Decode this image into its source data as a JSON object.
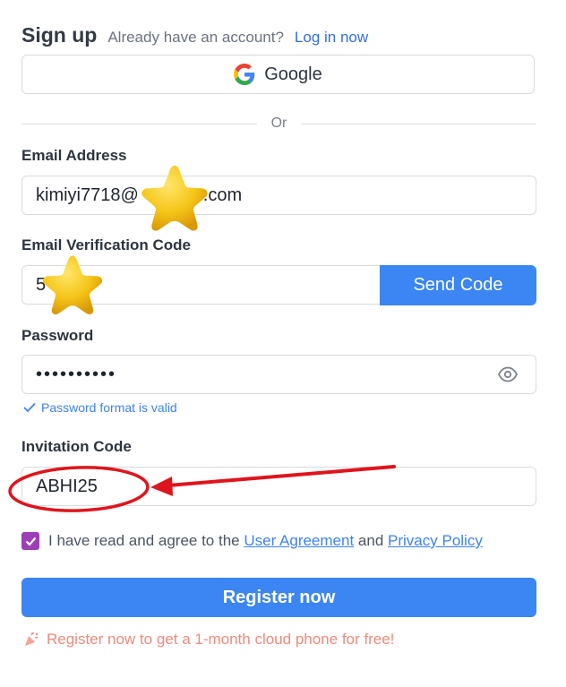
{
  "header": {
    "title": "Sign up",
    "subtitle": "Already have an account?",
    "login_link": "Log in now"
  },
  "google_button": {
    "label": "Google",
    "icon": "google-icon"
  },
  "divider": {
    "text": "Or"
  },
  "email": {
    "label": "Email Address",
    "value_prefix": "kimiyi7718@",
    "value_suffix": ".com"
  },
  "verification": {
    "label": "Email Verification Code",
    "value_prefix": "5",
    "send_label": "Send Code"
  },
  "password": {
    "label": "Password",
    "masked_value": "••••••••••",
    "eye_icon": "eye-icon",
    "valid_message": "Password format is valid"
  },
  "invitation": {
    "label": "Invitation Code",
    "value": "ABHI25"
  },
  "agreement": {
    "checked": true,
    "text_before": "I have read and agree to the",
    "user_agreement": "User Agreement",
    "and_text": "and",
    "privacy_policy": "Privacy Policy"
  },
  "register": {
    "label": "Register now"
  },
  "promo": {
    "text": "Register now to get a 1-month cloud phone for free!",
    "icon": "party-popper-icon"
  },
  "colors": {
    "accent": "#3b86f3",
    "link": "#3b82f6",
    "checkbox": "#9c3fb5",
    "promo": "#f08a7a",
    "annotation": "#e0141c",
    "star": "#f5c518"
  }
}
